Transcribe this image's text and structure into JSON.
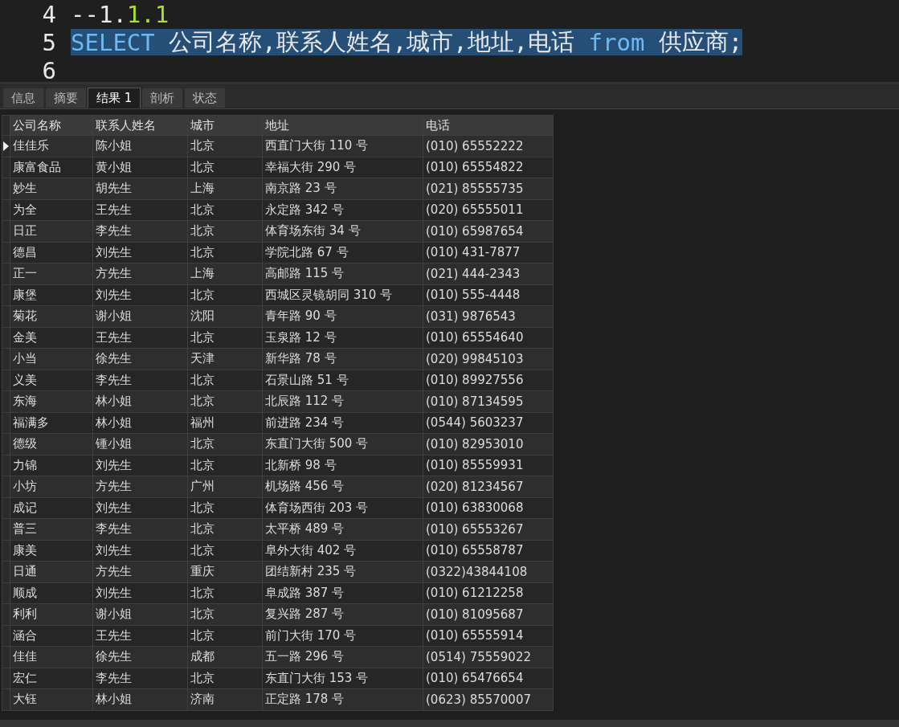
{
  "editor": {
    "lines": [
      {
        "number": "4",
        "selected": false,
        "tokens": [
          {
            "text": "--1.",
            "kind": "plain"
          },
          {
            "text": "1.1",
            "kind": "number"
          }
        ]
      },
      {
        "number": "5",
        "selected": true,
        "tokens": [
          {
            "text": "SELECT",
            "kind": "keyword"
          },
          {
            "text": " 公司名称,联系人姓名,城市,地址,电话 ",
            "kind": "plain"
          },
          {
            "text": "from",
            "kind": "keyword"
          },
          {
            "text": " 供应商;",
            "kind": "plain"
          }
        ]
      },
      {
        "number": "6",
        "selected": false
      }
    ]
  },
  "tabs": [
    {
      "label": "信息",
      "selected": false
    },
    {
      "label": "摘要",
      "selected": false
    },
    {
      "label": "结果 1",
      "selected": true
    },
    {
      "label": "剖析",
      "selected": false
    },
    {
      "label": "状态",
      "selected": false
    }
  ],
  "table": {
    "columns": [
      "公司名称",
      "联系人姓名",
      "城市",
      "地址",
      "电话"
    ],
    "rows": [
      {
        "selected": true,
        "cells": [
          "佳佳乐",
          "陈小姐",
          "北京",
          "西直门大街 110 号",
          "(010) 65552222"
        ]
      },
      {
        "selected": false,
        "cells": [
          "康富食品",
          "黄小姐",
          "北京",
          "幸福大街 290 号",
          "(010) 65554822"
        ]
      },
      {
        "selected": false,
        "cells": [
          "妙生",
          "胡先生",
          "上海",
          "南京路 23 号",
          "(021) 85555735"
        ]
      },
      {
        "selected": false,
        "cells": [
          "为全",
          "王先生",
          "北京",
          "永定路 342 号",
          "(020) 65555011"
        ]
      },
      {
        "selected": false,
        "cells": [
          "日正",
          "李先生",
          "北京",
          "体育场东街 34 号",
          "(010) 65987654"
        ]
      },
      {
        "selected": false,
        "cells": [
          "德昌",
          "刘先生",
          "北京",
          "学院北路 67 号",
          "(010) 431-7877"
        ]
      },
      {
        "selected": false,
        "cells": [
          "正一",
          "方先生",
          "上海",
          "高邮路 115 号",
          "(021) 444-2343"
        ]
      },
      {
        "selected": false,
        "cells": [
          "康堡",
          "刘先生",
          "北京",
          "西城区灵镜胡同 310 号",
          "(010) 555-4448"
        ]
      },
      {
        "selected": false,
        "cells": [
          "菊花",
          "谢小姐",
          "沈阳",
          "青年路 90 号",
          "(031) 9876543"
        ]
      },
      {
        "selected": false,
        "cells": [
          "金美",
          "王先生",
          "北京",
          "玉泉路 12 号",
          "(010) 65554640"
        ]
      },
      {
        "selected": false,
        "cells": [
          "小当",
          "徐先生",
          "天津",
          "新华路 78 号",
          "(020) 99845103"
        ]
      },
      {
        "selected": false,
        "cells": [
          "义美",
          "李先生",
          "北京",
          "石景山路 51 号",
          "(010) 89927556"
        ]
      },
      {
        "selected": false,
        "cells": [
          "东海",
          "林小姐",
          "北京",
          "北辰路 112 号",
          "(010) 87134595"
        ]
      },
      {
        "selected": false,
        "cells": [
          "福满多",
          "林小姐",
          "福州",
          "前进路 234 号",
          "(0544) 5603237"
        ]
      },
      {
        "selected": false,
        "cells": [
          "德级",
          "锺小姐",
          "北京",
          "东直门大街 500 号",
          "(010) 82953010"
        ]
      },
      {
        "selected": false,
        "cells": [
          "力锦",
          "刘先生",
          "北京",
          "北新桥 98 号",
          "(010) 85559931"
        ]
      },
      {
        "selected": false,
        "cells": [
          "小坊",
          "方先生",
          "广州",
          "机场路 456 号",
          "(020) 81234567"
        ]
      },
      {
        "selected": false,
        "cells": [
          "成记",
          "刘先生",
          "北京",
          "体育场西街 203 号",
          "(010) 63830068"
        ]
      },
      {
        "selected": false,
        "cells": [
          "普三",
          "李先生",
          "北京",
          "太平桥 489 号",
          "(010) 65553267"
        ]
      },
      {
        "selected": false,
        "cells": [
          "康美",
          "刘先生",
          "北京",
          "阜外大街 402 号",
          "(010) 65558787"
        ]
      },
      {
        "selected": false,
        "cells": [
          "日通",
          "方先生",
          "重庆",
          "团结新村 235 号",
          "(0322)43844108"
        ]
      },
      {
        "selected": false,
        "cells": [
          "顺成",
          "刘先生",
          "北京",
          "阜成路 387 号",
          "(010) 61212258"
        ]
      },
      {
        "selected": false,
        "cells": [
          "利利",
          "谢小姐",
          "北京",
          "复兴路 287 号",
          "(010) 81095687"
        ]
      },
      {
        "selected": false,
        "cells": [
          "涵合",
          "王先生",
          "北京",
          "前门大街 170 号",
          "(010) 65555914"
        ]
      },
      {
        "selected": false,
        "cells": [
          "佳佳",
          "徐先生",
          "成都",
          "五一路 296 号",
          "(0514) 75559022"
        ]
      },
      {
        "selected": false,
        "cells": [
          "宏仁",
          "李先生",
          "北京",
          "东直门大街 153 号",
          "(010) 65476654"
        ]
      },
      {
        "selected": false,
        "cells": [
          "大钰",
          "林小姐",
          "济南",
          "正定路 178 号",
          "(0623) 85570007"
        ]
      }
    ]
  }
}
